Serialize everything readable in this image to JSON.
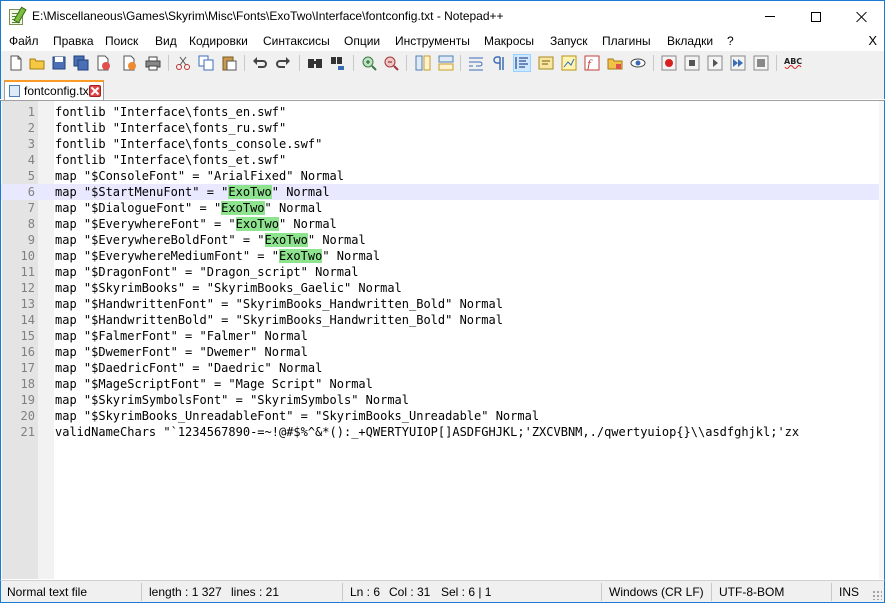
{
  "window": {
    "title": "E:\\Miscellaneous\\Games\\Skyrim\\Misc\\Fonts\\ExoTwo\\Interface\\fontconfig.txt - Notepad++"
  },
  "menu": {
    "items": [
      "Файл",
      "Правка",
      "Поиск",
      "Вид",
      "Кодировки",
      "Синтаксисы",
      "Опции",
      "Инструменты",
      "Макросы",
      "Запуск",
      "Плагины",
      "Вкладки",
      "?"
    ],
    "close_doc": "X"
  },
  "toolbar": {
    "icons": [
      "new-file-icon",
      "open-file-icon",
      "save-icon",
      "save-all-icon",
      "close-file-icon",
      "close-all-icon",
      "print-icon",
      "cut-icon",
      "copy-icon",
      "paste-icon",
      "undo-icon",
      "redo-icon",
      "find-icon",
      "replace-icon",
      "zoom-in-icon",
      "zoom-out-icon",
      "sync-vertical-icon",
      "sync-horizontal-icon",
      "word-wrap-icon",
      "show-all-chars-icon",
      "indent-guide-icon",
      "user-language-icon",
      "doc-map-icon",
      "function-list-icon",
      "folder-workspace-icon",
      "monitoring-icon",
      "record-macro-icon",
      "stop-macro-icon",
      "play-macro-icon",
      "run-macro-multiple-icon",
      "save-macro-icon",
      "spell-check-icon"
    ],
    "active_icon": "indent-guide-icon",
    "spell_label": "ABC"
  },
  "tab": {
    "label": "fontconfig.txt"
  },
  "editor": {
    "current_line": 6,
    "highlight_word": "ExoTwo",
    "highlight_color": "#8ee38e",
    "current_line_color": "#e8e8ff",
    "lines": [
      {
        "n": "1",
        "text": "fontlib \"Interface\\fonts_en.swf\""
      },
      {
        "n": "2",
        "text": "fontlib \"Interface\\fonts_ru.swf\""
      },
      {
        "n": "3",
        "text": "fontlib \"Interface\\fonts_console.swf\""
      },
      {
        "n": "4",
        "text": "fontlib \"Interface\\fonts_et.swf\""
      },
      {
        "n": "5",
        "text": "map \"$ConsoleFont\" = \"ArialFixed\" Normal"
      },
      {
        "n": "6",
        "text": "map \"$StartMenuFont\" = \"ExoTwo\" Normal"
      },
      {
        "n": "7",
        "text": "map \"$DialogueFont\" = \"ExoTwo\" Normal"
      },
      {
        "n": "8",
        "text": "map \"$EverywhereFont\" = \"ExoTwo\" Normal"
      },
      {
        "n": "9",
        "text": "map \"$EverywhereBoldFont\" = \"ExoTwo\" Normal"
      },
      {
        "n": "10",
        "text": "map \"$EverywhereMediumFont\" = \"ExoTwo\" Normal"
      },
      {
        "n": "11",
        "text": "map \"$DragonFont\" = \"Dragon_script\" Normal"
      },
      {
        "n": "12",
        "text": "map \"$SkyrimBooks\" = \"SkyrimBooks_Gaelic\" Normal"
      },
      {
        "n": "13",
        "text": "map \"$HandwrittenFont\" = \"SkyrimBooks_Handwritten_Bold\" Normal"
      },
      {
        "n": "14",
        "text": "map \"$HandwrittenBold\" = \"SkyrimBooks_Handwritten_Bold\" Normal"
      },
      {
        "n": "15",
        "text": "map \"$FalmerFont\" = \"Falmer\" Normal"
      },
      {
        "n": "16",
        "text": "map \"$DwemerFont\" = \"Dwemer\" Normal"
      },
      {
        "n": "17",
        "text": "map \"$DaedricFont\" = \"Daedric\" Normal"
      },
      {
        "n": "18",
        "text": "map \"$MageScriptFont\" = \"Mage Script\" Normal"
      },
      {
        "n": "19",
        "text": "map \"$SkyrimSymbolsFont\" = \"SkyrimSymbols\" Normal"
      },
      {
        "n": "20",
        "text": "map \"$SkyrimBooks_UnreadableFont\" = \"SkyrimBooks_Unreadable\" Normal"
      },
      {
        "n": "21",
        "text": "validNameChars \"`1234567890-=~!@#$%^&*():_+QWERTYUIOP[]ASDFGHJKL;'ZXCVBNM,./qwertyuiop{}\\\\asdfghjkl;'zx"
      }
    ]
  },
  "status": {
    "file_type": "Normal text file",
    "length": "length : 1 327",
    "lines": "lines : 21",
    "ln": "Ln : 6",
    "col": "Col : 31",
    "sel": "Sel : 6 | 1",
    "eol": "Windows (CR LF)",
    "encoding": "UTF-8-BOM",
    "mode": "INS"
  }
}
